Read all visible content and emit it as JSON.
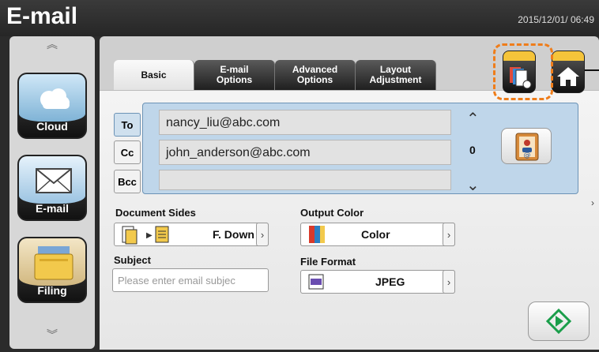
{
  "header": {
    "title": "E-mail",
    "datetime": "2015/12/01/ 06:49"
  },
  "sidebar": {
    "items": [
      {
        "label": "Cloud",
        "icon": "cloud-icon"
      },
      {
        "label": "E-mail",
        "icon": "envelope-icon"
      },
      {
        "label": "Filing",
        "icon": "folder-icon"
      }
    ]
  },
  "tabs": [
    {
      "label": "Basic",
      "active": true
    },
    {
      "label": "E-mail\nOptions",
      "active": false
    },
    {
      "label": "Advanced\nOptions",
      "active": false
    },
    {
      "label": "Layout\nAdjustment",
      "active": false
    }
  ],
  "recipients": {
    "to_label": "To",
    "cc_label": "Cc",
    "bcc_label": "Bcc",
    "to_value": "nancy_liu@abc.com",
    "cc_value": "john_anderson@abc.com",
    "bcc_value": "",
    "count": "0"
  },
  "document_sides": {
    "label": "Document Sides",
    "value": "F. Down"
  },
  "output_color": {
    "label": "Output Color",
    "value": "Color"
  },
  "subject": {
    "label": "Subject",
    "placeholder": "Please enter email subjec"
  },
  "file_format": {
    "label": "File Format",
    "value": "JPEG"
  },
  "colors": {
    "accent": "#ef7d1a",
    "start_green": "#1a9e4a"
  }
}
